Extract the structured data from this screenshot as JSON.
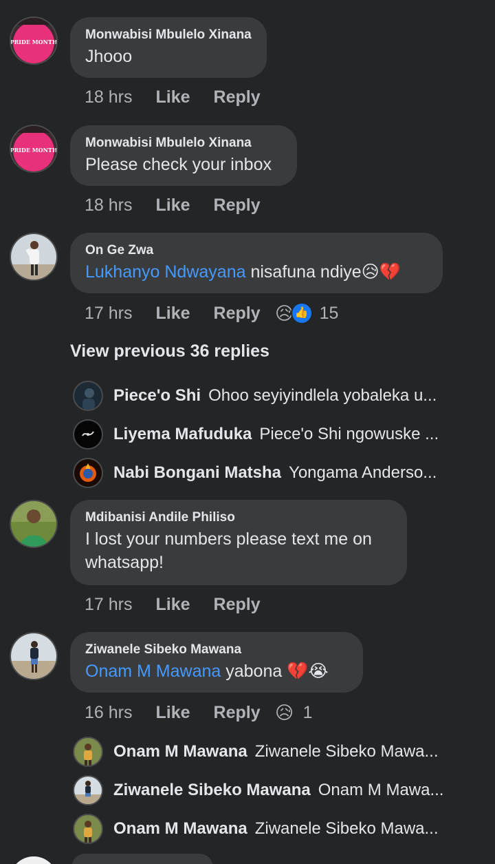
{
  "comments": [
    {
      "author": "Monwabisi Mbulelo Xinana",
      "avatar": "pride-month-shirt-avatar",
      "avatar_text": "PRIDE MONTH",
      "mention": "",
      "text": "Jhooo",
      "time": "18 hrs",
      "like_label": "Like",
      "reply_label": "Reply"
    },
    {
      "author": "Monwabisi Mbulelo Xinana",
      "avatar": "pride-month-shirt-avatar",
      "avatar_text": "PRIDE MONTH",
      "mention": "",
      "text": "Please check your inbox",
      "time": "18 hrs",
      "like_label": "Like",
      "reply_label": "Reply"
    },
    {
      "author": "On Ge Zwa",
      "avatar": "person-standing-avatar",
      "mention": "Lukhanyo Ndwayana",
      "text": "nisafuna ndiye😥💔",
      "time": "17 hrs",
      "like_label": "Like",
      "reply_label": "Reply",
      "reactions": [
        "😥",
        "👍"
      ],
      "reaction_count": "15"
    },
    {
      "author": "Mdibanisi Andile Philiso",
      "avatar": "person-green-sweater-avatar",
      "mention": "",
      "text": "I lost your numbers please text me on whatsapp!",
      "time": "17 hrs",
      "like_label": "Like",
      "reply_label": "Reply"
    },
    {
      "author": "Ziwanele Sibeko Mawana",
      "avatar": "person-on-road-avatar",
      "mention": "Onam M Mawana",
      "text": "yabona 💔😭",
      "time": "16 hrs",
      "like_label": "Like",
      "reply_label": "Reply",
      "reactions": [
        "😥"
      ],
      "reaction_count": "1"
    }
  ],
  "view_previous_label": "View previous 36 replies",
  "thread_one_replies": [
    {
      "name": "Piece'o Shi",
      "snippet": "Ohoo seyiyindlela yobaleka u...",
      "avatar": "dark-photo-avatar"
    },
    {
      "name": "Liyema Mafuduka",
      "snippet": "Piece'o Shi ngowuske ...",
      "avatar": "black-logo-avatar"
    },
    {
      "name": "Nabi Bongani Matsha",
      "snippet": "Yongama Anderso...",
      "avatar": "fire-globe-avatar"
    }
  ],
  "thread_two_replies": [
    {
      "name": "Onam M Mawana",
      "snippet": "Ziwanele Sibeko Mawa...",
      "avatar": "person-outdoor-avatar"
    },
    {
      "name": "Ziwanele Sibeko Mawana",
      "snippet": "Onam M Mawa...",
      "avatar": "person-on-road-avatar"
    },
    {
      "name": "Onam M Mawana",
      "snippet": "Ziwanele Sibeko Mawa...",
      "avatar": "person-outdoor-avatar"
    }
  ],
  "colors": {
    "background": "#242526",
    "bubble": "#3a3b3c",
    "mention": "#4599ff",
    "meta_text": "#b0b3b8",
    "like_reaction": "#1877f2"
  }
}
